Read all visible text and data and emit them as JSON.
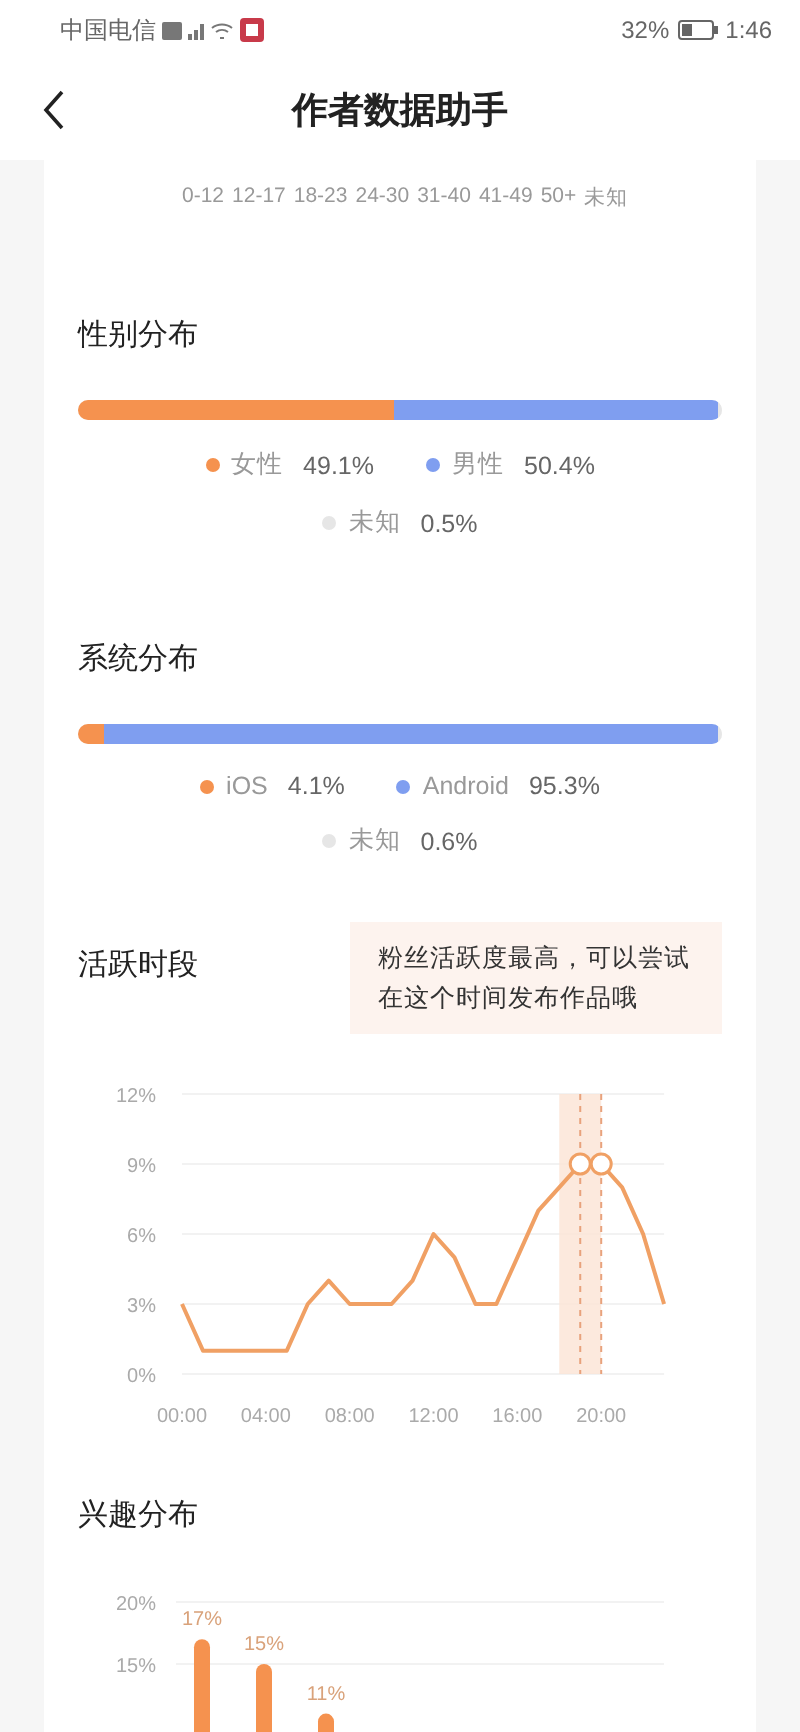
{
  "status_bar": {
    "carrier": "中国电信",
    "battery": "32%",
    "time": "1:46"
  },
  "header": {
    "title": "作者数据助手"
  },
  "age_section": {
    "axis_labels": [
      "0-12",
      "12-17",
      "18-23",
      "24-30",
      "31-40",
      "41-49",
      "50+",
      "未知"
    ]
  },
  "gender": {
    "title": "性别分布",
    "segments": [
      {
        "label": "女性",
        "value": "49.1%",
        "level": 0.491,
        "color": "#f5924f"
      },
      {
        "label": "男性",
        "value": "50.4%",
        "level": 0.504,
        "color": "#7f9ef0"
      },
      {
        "label": "未知",
        "value": "0.5%",
        "level": 0.005,
        "color": "#e6e6e6"
      }
    ]
  },
  "system": {
    "title": "系统分布",
    "segments": [
      {
        "label": "iOS",
        "value": "4.1%",
        "level": 0.041,
        "color": "#f5924f"
      },
      {
        "label": "Android",
        "value": "95.3%",
        "level": 0.953,
        "color": "#7f9ef0"
      },
      {
        "label": "未知",
        "value": "0.6%",
        "level": 0.006,
        "color": "#e6e6e6"
      }
    ]
  },
  "active": {
    "title": "活跃时段",
    "tip": "粉丝活跃度最高，可以尝试在这个时间发布作品哦",
    "chart_data": {
      "type": "line",
      "x": [
        0,
        1,
        2,
        3,
        4,
        5,
        6,
        7,
        8,
        9,
        10,
        11,
        12,
        13,
        14,
        15,
        16,
        17,
        18,
        19,
        20,
        21,
        22,
        23
      ],
      "series": [
        {
          "color": "#f0a064",
          "values": [
            3,
            1,
            1,
            1,
            1,
            1,
            3,
            4,
            3,
            3,
            3,
            4,
            6,
            5,
            3,
            3,
            5,
            7,
            8,
            9,
            9,
            8,
            6,
            3
          ]
        }
      ],
      "xlim": [
        0,
        23
      ],
      "ylim": [
        0,
        12
      ],
      "grid": true,
      "yticks": [
        {
          "value": 0,
          "label": "0%"
        },
        {
          "value": 3,
          "label": "3%"
        },
        {
          "value": 6,
          "label": "6%"
        },
        {
          "value": 9,
          "label": "9%"
        },
        {
          "value": 12,
          "label": "12%"
        }
      ],
      "xticks": [
        {
          "value": 0,
          "label": "00:00"
        },
        {
          "value": 4,
          "label": "04:00"
        },
        {
          "value": 8,
          "label": "08:00"
        },
        {
          "value": 12,
          "label": "12:00"
        },
        {
          "value": 16,
          "label": "16:00"
        },
        {
          "value": 20,
          "label": "20:00"
        }
      ],
      "bands": [
        {
          "axis": "x",
          "from": 18,
          "to": 20
        }
      ],
      "ref_lines": [
        {
          "axis": "x",
          "value": 19
        },
        {
          "axis": "x",
          "value": 20
        }
      ]
    }
  },
  "interest": {
    "title": "兴趣分布",
    "chart_data": {
      "type": "bar",
      "value_labels": [
        "17%",
        "15%",
        "11%"
      ],
      "ylim": [
        0,
        20
      ],
      "grid": true,
      "yticks": [
        {
          "value": 15,
          "label": "15%"
        },
        {
          "value": 20,
          "label": "20%"
        }
      ],
      "series": [
        {
          "color": "#f5924f",
          "values": [
            17,
            15,
            11
          ]
        }
      ]
    }
  }
}
